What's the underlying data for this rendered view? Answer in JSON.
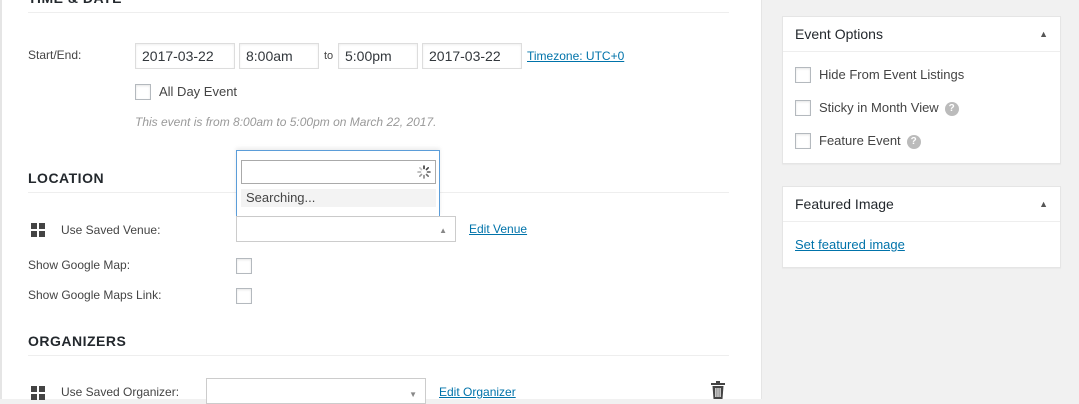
{
  "time_date": {
    "title": "TIME & DATE",
    "label": "Start/End:",
    "start_date": "2017-03-22",
    "start_time": "8:00am",
    "to": "to",
    "end_time": "5:00pm",
    "end_date": "2017-03-22",
    "timezone": "Timezone: UTC+0",
    "all_day": "All Day Event",
    "summary": "This event is from 8:00am to 5:00pm on March 22, 2017."
  },
  "location": {
    "title": "LOCATION",
    "saved_venue_label": "Use Saved Venue:",
    "edit_venue": "Edit Venue",
    "show_map_label": "Show Google Map:",
    "show_map_link_label": "Show Google Maps Link:",
    "search_status": "Searching..."
  },
  "organizers": {
    "title": "ORGANIZERS",
    "saved_organizer_label": "Use Saved Organizer:",
    "edit_organizer": "Edit Organizer"
  },
  "event_options": {
    "title": "Event Options",
    "items": [
      {
        "label": "Hide From Event Listings"
      },
      {
        "label": "Sticky in Month View"
      },
      {
        "label": "Feature Event"
      }
    ]
  },
  "featured_image": {
    "title": "Featured Image",
    "link": "Set featured image"
  },
  "icons": {
    "help": "?",
    "collapse": "▲",
    "dropdown": "▼"
  }
}
